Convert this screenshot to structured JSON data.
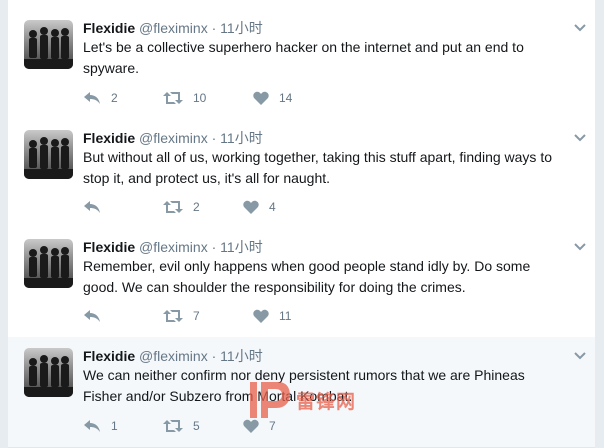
{
  "colors": {
    "name": "#14171a",
    "meta": "#657786",
    "icon": "#8899a6",
    "divider": "#e1e8ed",
    "highlight_bg": "#f5f8fa",
    "watermark": "#e8604c"
  },
  "icons": {
    "reply": "reply-icon",
    "retweet": "retweet-icon",
    "like": "heart-icon",
    "menu": "chevron-down-icon"
  },
  "tweets": [
    {
      "name": "Flexidie",
      "handle": "@fleximinx",
      "dot": "·",
      "time": "11小时",
      "text": "Let's be a collective superhero hacker on the internet and put an end to spyware.",
      "replies": "2",
      "retweets": "10",
      "likes": "14"
    },
    {
      "name": "Flexidie",
      "handle": "@fleximinx",
      "dot": "·",
      "time": "11小时",
      "text": "But without all of us, working together, taking this stuff apart, finding ways to stop it, and protect us, it's all for naught.",
      "replies": "",
      "retweets": "2",
      "likes": "4"
    },
    {
      "name": "Flexidie",
      "handle": "@fleximinx",
      "dot": "·",
      "time": "11小时",
      "text": "Remember, evil only happens when good people stand idly by. Do some good. We can shoulder the responsibility for doing the crimes.",
      "replies": "",
      "retweets": "7",
      "likes": "11"
    },
    {
      "name": "Flexidie",
      "handle": "@fleximinx",
      "dot": "·",
      "time": "11小时",
      "text": "We can neither confirm nor deny persistent rumors that we are Phineas Fisher and/or Subzero from Mortal Kombat.",
      "replies": "1",
      "retweets": "5",
      "likes": "7"
    }
  ],
  "watermark": {
    "text": "雷锋网",
    "logo": "leiphone-logo"
  }
}
